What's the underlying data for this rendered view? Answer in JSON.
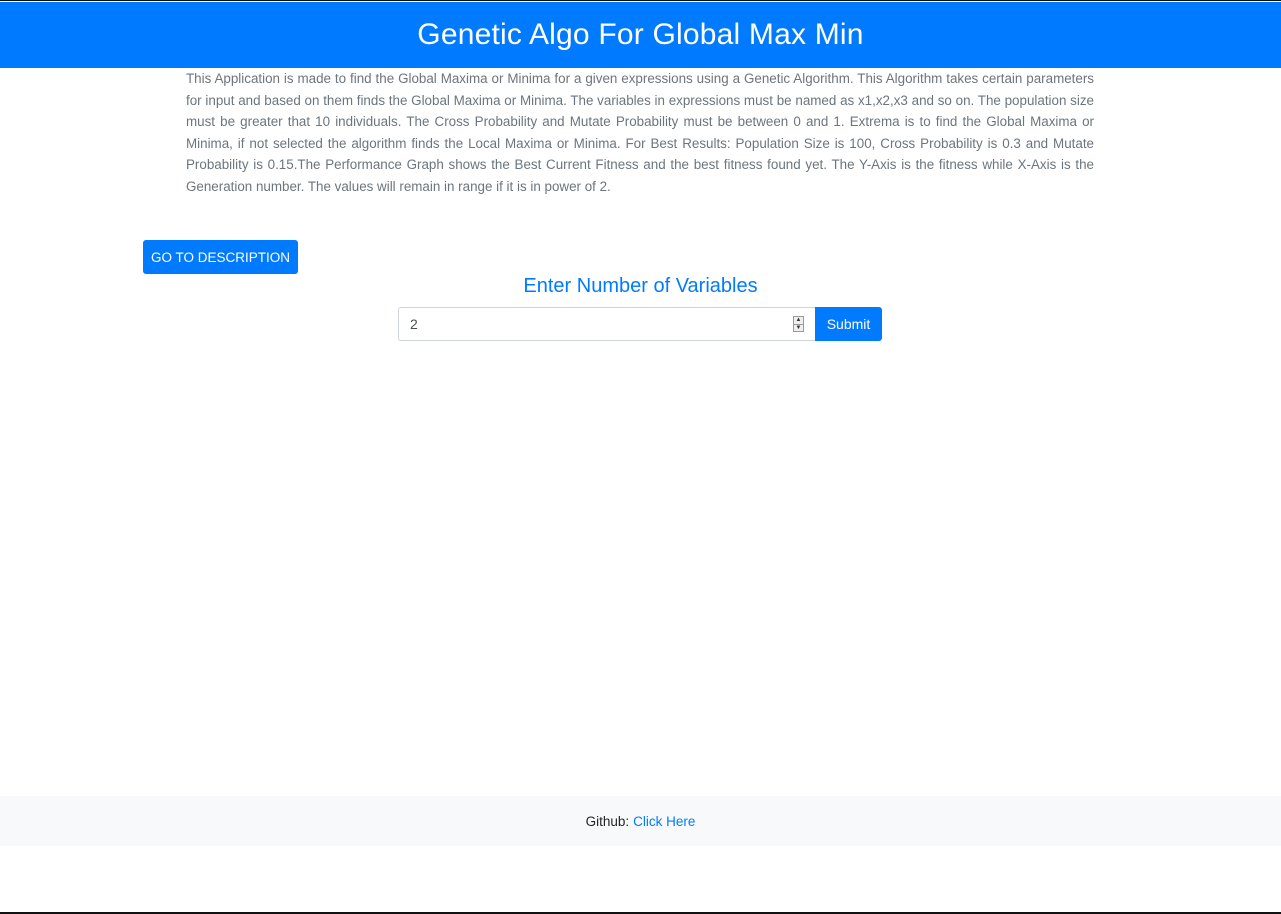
{
  "header": {
    "title": "Genetic Algo For Global Max Min"
  },
  "description": {
    "text": "This Application is made to find the Global Maxima or Minima for a given expressions using a Genetic Algorithm. This Algorithm takes certain parameters for input and based on them finds the Global Maxima or Minima. The variables in expressions must be named as x1,x2,x3 and so on. The population size must be greater that 10 individuals. The Cross Probability and Mutate Probability must be between 0 and 1. Extrema is to find the Global Maxima or Minima, if not selected the algorithm finds the Local Maxima or Minima. For Best Results: Population Size is 100, Cross Probability is 0.3 and Mutate Probability is 0.15.The Performance Graph shows the Best Current Fitness and the best fitness found yet. The Y-Axis is the fitness while X-Axis is the Generation number. The values will remain in range if it is in power of 2."
  },
  "actions": {
    "go_to_description_label": "GO TO DESCRIPTION"
  },
  "variables_form": {
    "title": "Enter Number of Variables",
    "input_value": "2",
    "spinner_up": "▲",
    "spinner_down": "▼",
    "submit_label": "Submit"
  },
  "footer": {
    "label": "Github:",
    "link_text": "Click Here"
  },
  "colors": {
    "primary": "#007bff",
    "muted_text": "#6c757d",
    "footer_bg": "#f8f9fa"
  }
}
